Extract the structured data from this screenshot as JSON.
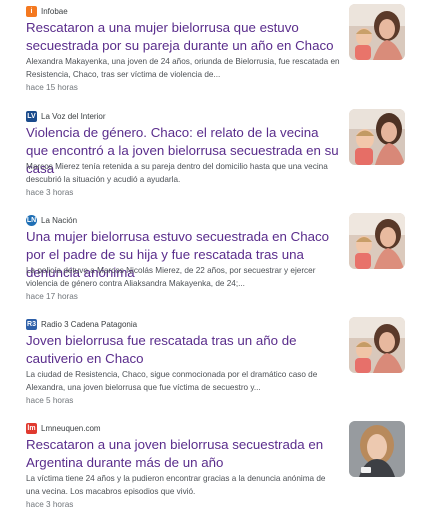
{
  "articles": [
    {
      "source": "Infobae",
      "logo_text": "i",
      "logo_color": "#f47920",
      "title": "Rescataron a una mujer bielorrusa que estuvo secuestrada por su pareja durante un año en Chaco",
      "snippet": "Alexandra Makayenka, una joven de 24 años, oriunda de Bielorrusia, fue rescatada en Resistencia, Chaco, tras ser víctima de violencia de...",
      "time": "hace 15 horas",
      "thumbnail_icon": "photo-woman-with-child"
    },
    {
      "source": "La Voz del Interior",
      "logo_text": "LV",
      "logo_color": "#1a4b8c",
      "title": "Violencia de género. Chaco: el relato de la vecina que encontró a la joven bielorrusa secuestrada en su casa",
      "snippet": "Marcos Mierez tenía retenida a su pareja dentro del domicilio hasta que una vecina descubrió la situación y acudió a ayudarla.",
      "time": "hace 3 horas",
      "thumbnail_icon": "photo-woman-with-child"
    },
    {
      "source": "La Nación",
      "logo_text": "LN",
      "logo_color": "#1f6fb5",
      "title": "Una mujer bielorrusa estuvo secuestrada en Chaco por el padre de su hija y fue rescatada tras una denuncia anónima",
      "snippet": "La policía detuvo a Marcos Nicolás Mierez, de 22 años, por secuestrar y ejercer violencia de género contra Aliaksandra Makayenka, de 24;...",
      "time": "hace 17 horas",
      "thumbnail_icon": "photo-woman-with-child"
    },
    {
      "source": "Radio 3 Cadena Patagonia",
      "logo_text": "R3",
      "logo_color": "#2d5fa8",
      "title": "Joven bielorrusa fue rescatada tras un año de cautiverio en Chaco",
      "snippet": "La ciudad de Resistencia, Chaco, sigue conmocionada por el dramático caso de Alexandra, una joven bielorrusa que fue víctima de secuestro y...",
      "time": "hace 5 horas",
      "thumbnail_icon": "photo-woman-with-child"
    },
    {
      "source": "Lmneuquen.com",
      "logo_text": "lm",
      "logo_color": "#e03a2f",
      "title": "Rescataron a una joven bielorrusa secuestrada en Argentina durante más de un año",
      "snippet": "La víctima tiene 24 años y la pudieron encontrar gracias a la denuncia anónima de una vecina. Los macabros episodios que vivió.",
      "time": "hace 3 horas",
      "thumbnail_icon": "photo-woman-portrait"
    }
  ]
}
